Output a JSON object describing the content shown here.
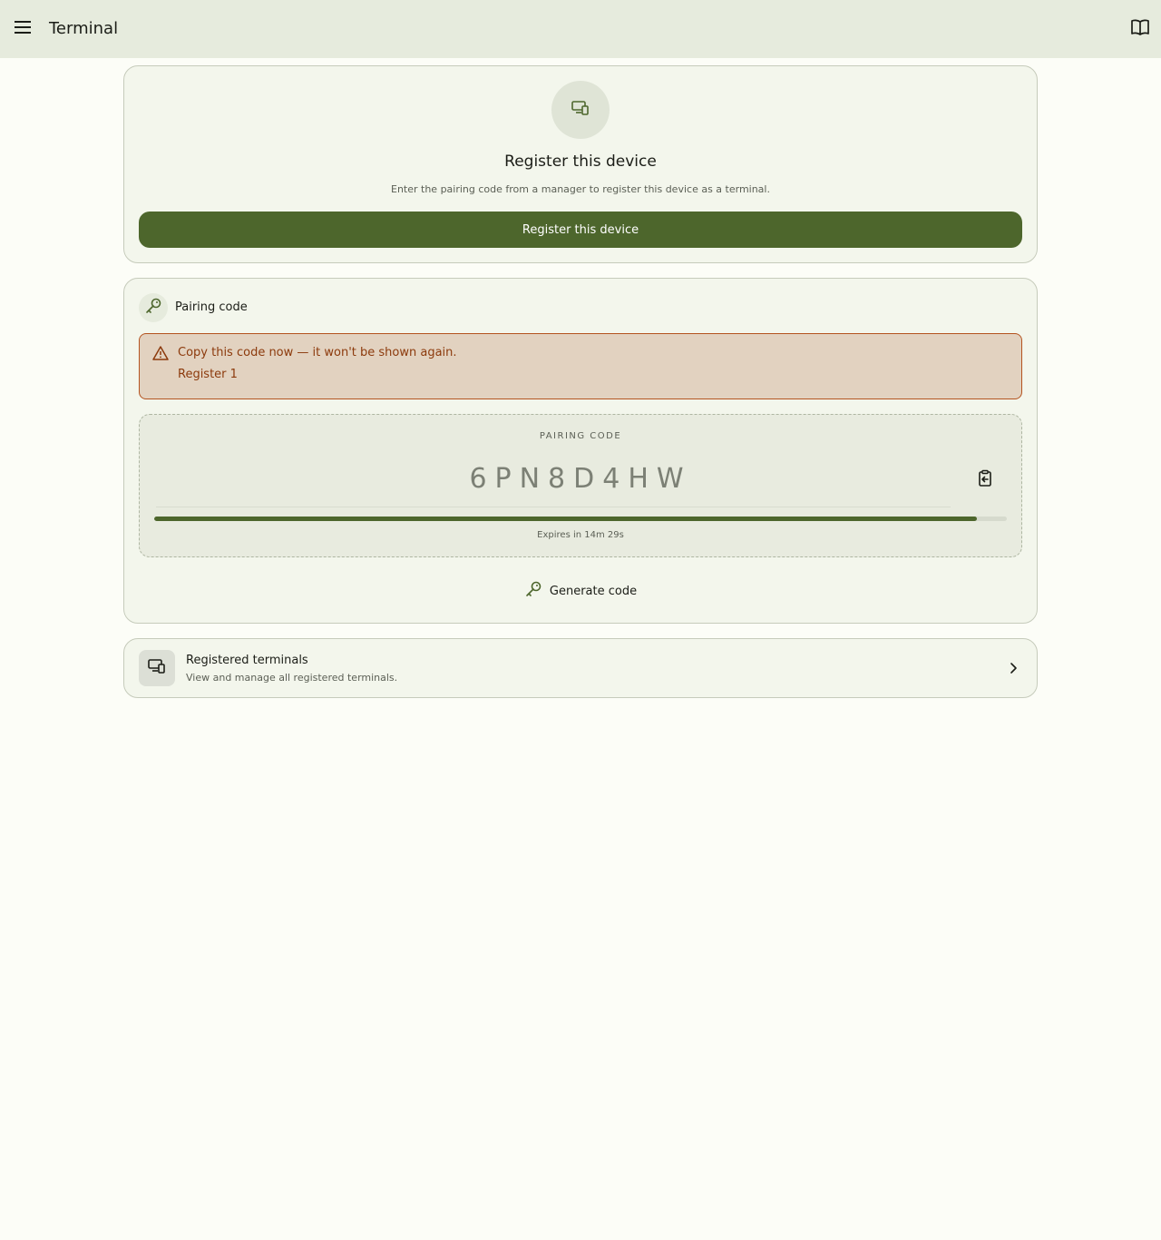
{
  "topbar": {
    "title": "Terminal",
    "menu_icon": "menu-icon",
    "docs_icon": "book-open-icon"
  },
  "register_card": {
    "icon": "devices-icon",
    "title": "Register this device",
    "description": "Enter the pairing code from a manager to register this device as a terminal.",
    "button_label": "Register this device"
  },
  "pairing_card": {
    "header_icon": "key-icon",
    "header_label": "Pairing code",
    "warning": {
      "icon": "warning-icon",
      "message": "Copy this code now — it won't be shown again.",
      "terminal_name": "Register 1"
    },
    "code_label": "PAIRING CODE",
    "code": "6PN8D4HW",
    "copy_icon": "clipboard-copy-icon",
    "expires_text": "Expires in 14m 29s",
    "progress_fraction": 0.965,
    "generate_button_label": "Generate code",
    "generate_icon": "key-icon"
  },
  "terminals_card": {
    "icon": "devices-icon",
    "title": "Registered terminals",
    "subtitle": "View and manage all registered terminals.",
    "chevron_icon": "chevron-right-icon"
  },
  "colors": {
    "primary": "#4d662c",
    "topbar_bg": "#e6ebdd",
    "warning_bg": "#e2d2c0",
    "warning_border": "#b4531f",
    "warning_text": "#8c3a0c"
  }
}
